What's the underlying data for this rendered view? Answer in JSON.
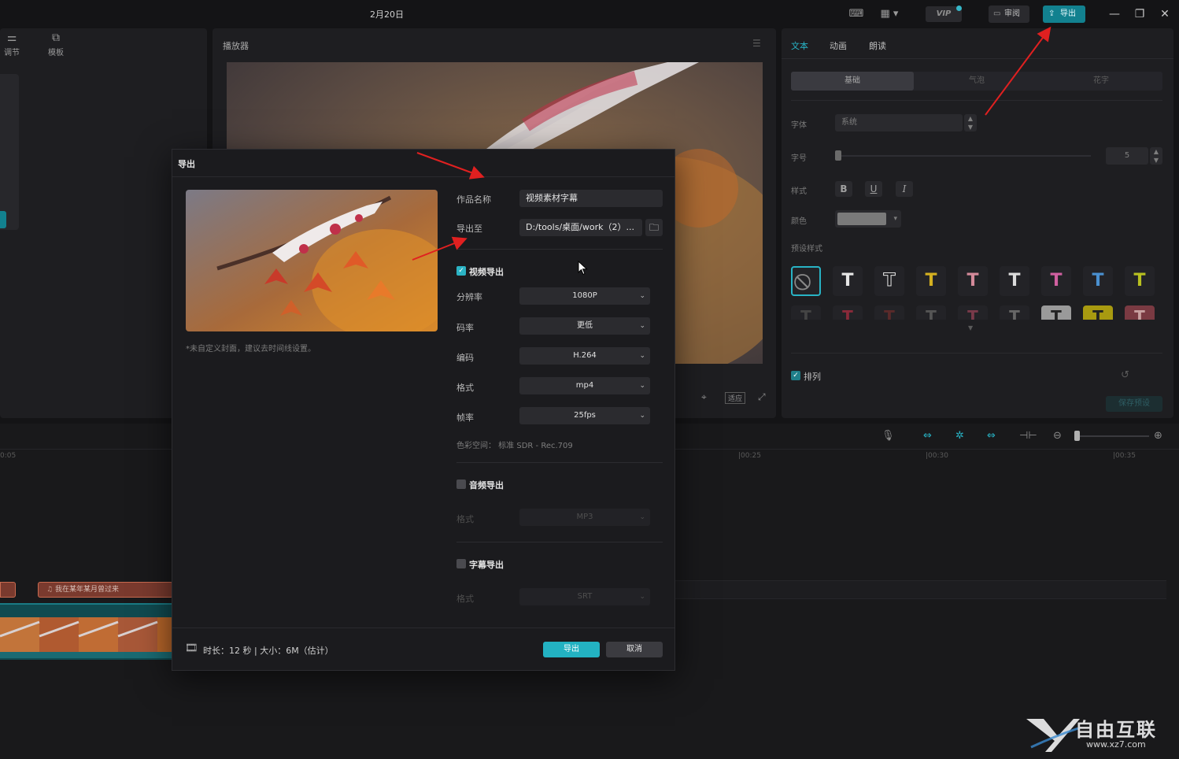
{
  "titlebar": {
    "date": "2月20日",
    "review": "审阅",
    "export": "导出",
    "vip": "VIP"
  },
  "left_panel": {
    "tabs": [
      "调节",
      "模板"
    ]
  },
  "player": {
    "title": "播放器",
    "fit": "适应"
  },
  "right_panel": {
    "tabs": [
      "文本",
      "动画",
      "朗读"
    ],
    "segments": [
      "基础",
      "气泡",
      "花字"
    ],
    "font_label": "字体",
    "font_value": "系统",
    "size_label": "字号",
    "size_value": "5",
    "style_label": "样式",
    "style_buttons": [
      "B",
      "U",
      "I"
    ],
    "color_label": "颜色",
    "preset_label": "预设样式",
    "arrange_label": "排列",
    "save_preset": "保存预设"
  },
  "timeline": {
    "ticks": [
      "0:05",
      "|00:25",
      "|00:30",
      "|00:35"
    ],
    "clip_text": "我在某年某月曾过来"
  },
  "dialog": {
    "title": "导出",
    "cover_note": "*未自定义封面，建议去时间线设置。",
    "name_label": "作品名称",
    "name_value": "视频素材字幕",
    "path_label": "导出至",
    "path_value": "D:/tools/桌面/work（2）...",
    "video": {
      "title": "视频导出",
      "checked": true,
      "resolution_label": "分辨率",
      "resolution": "1080P",
      "bitrate_label": "码率",
      "bitrate": "更低",
      "codec_label": "编码",
      "codec": "H.264",
      "format_label": "格式",
      "format": "mp4",
      "fps_label": "帧率",
      "fps": "25fps",
      "color_space": "色彩空间：  标准 SDR - Rec.709"
    },
    "audio": {
      "title": "音频导出",
      "checked": false,
      "format_label": "格式",
      "format": "MP3"
    },
    "subtitle": {
      "title": "字幕导出",
      "checked": false,
      "format_label": "格式",
      "format": "SRT"
    },
    "footer_info": "时长：12 秒 | 大小：6M（估计）",
    "export_button": "导出",
    "cancel_button": "取消"
  },
  "watermark": {
    "text": "自由互联",
    "url": "www.xz7.com"
  },
  "colors": {
    "accent": "#23b2c2",
    "export_top": "#12818f",
    "annotation_arrow": "#e02020"
  }
}
